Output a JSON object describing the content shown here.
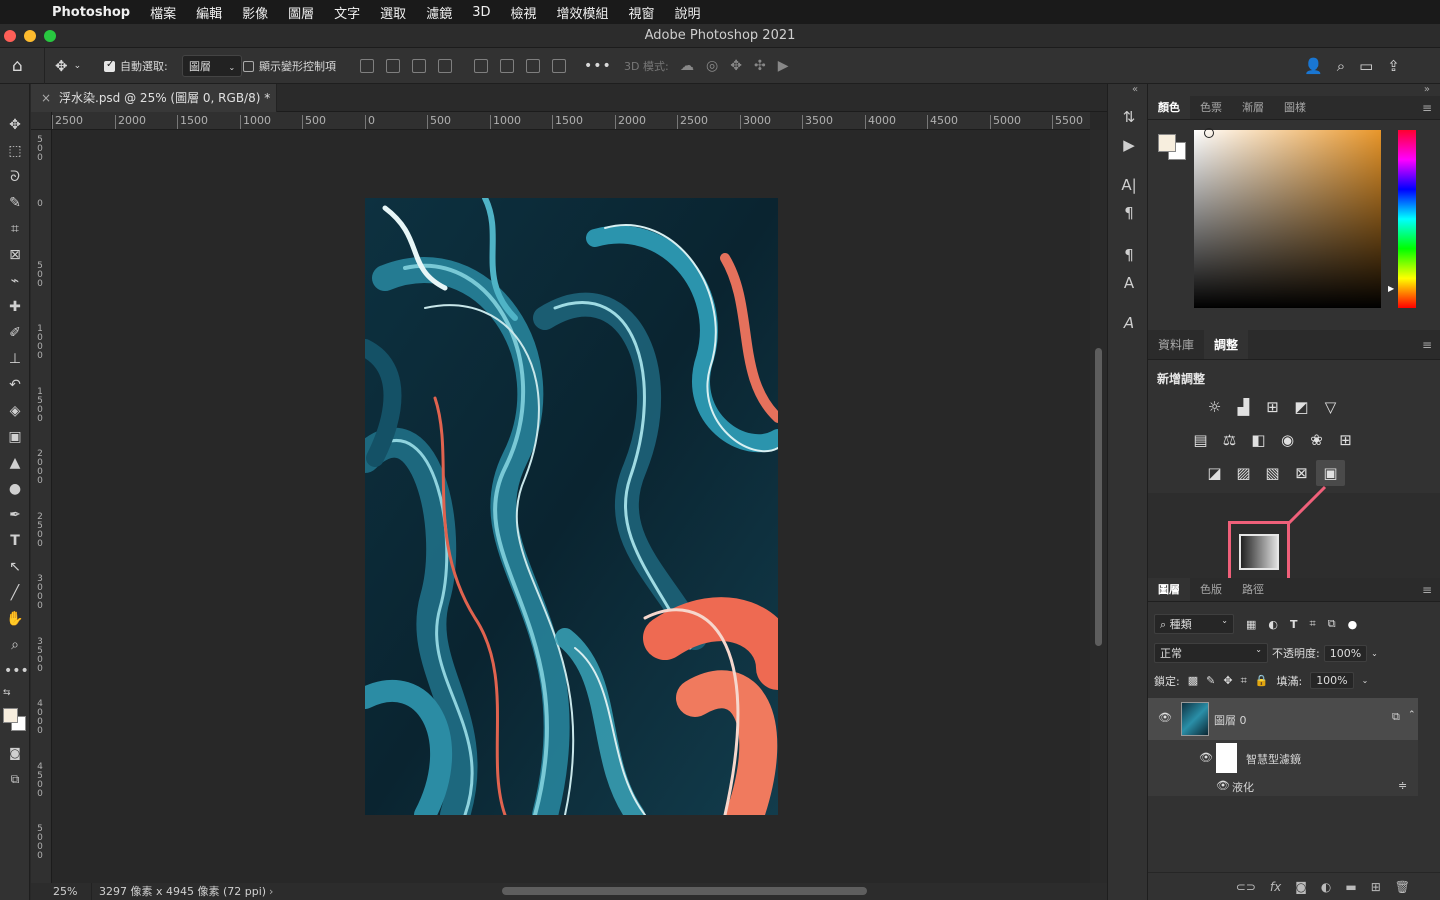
{
  "menubar": {
    "app_name": "Photoshop",
    "items": [
      "檔案",
      "編輯",
      "影像",
      "圖層",
      "文字",
      "選取",
      "濾鏡",
      "3D",
      "檢視",
      "增效模組",
      "視窗",
      "說明"
    ]
  },
  "window": {
    "title": "Adobe Photoshop 2021"
  },
  "options_bar": {
    "auto_select_label": "自動選取:",
    "auto_select_value": "圖層",
    "show_transform_label": "顯示變形控制項",
    "mode_3d_label": "3D 模式:"
  },
  "document": {
    "tab_title": "浮水染.psd @ 25% (圖層 0, RGB/8) *",
    "close_glyph": "×",
    "zoom": "25%",
    "info": "3297 像素 x 4945 像素 (72 ppi)",
    "h_ruler": [
      "2500",
      "2000",
      "1500",
      "1000",
      "500",
      "0",
      "500",
      "1000",
      "1500",
      "2000",
      "2500",
      "3000",
      "3500",
      "4000",
      "4500",
      "5000",
      "5500"
    ],
    "v_ruler": [
      "500",
      "0",
      "500",
      "1000",
      "1500",
      "2000",
      "2500",
      "3000",
      "3500",
      "4000",
      "4500",
      "5000"
    ]
  },
  "color_panel": {
    "tabs": [
      "顏色",
      "色票",
      "漸層",
      "圖樣"
    ],
    "foreground": "#f7eede",
    "background": "#ffffff"
  },
  "adjust_panel": {
    "tabs": [
      "資料庫",
      "調整"
    ],
    "heading": "新增調整",
    "highlight_color": "#f0607a"
  },
  "layers_panel": {
    "tabs": [
      "圖層",
      "色版",
      "路徑"
    ],
    "filter_label": "種類",
    "blend_mode": "正常",
    "opacity_label": "不透明度:",
    "opacity_value": "100%",
    "lock_label": "鎖定:",
    "fill_label": "填滿:",
    "fill_value": "100%",
    "layers": [
      {
        "name": "圖層 0"
      },
      {
        "name": "智慧型濾鏡"
      },
      {
        "name": "液化"
      }
    ]
  }
}
